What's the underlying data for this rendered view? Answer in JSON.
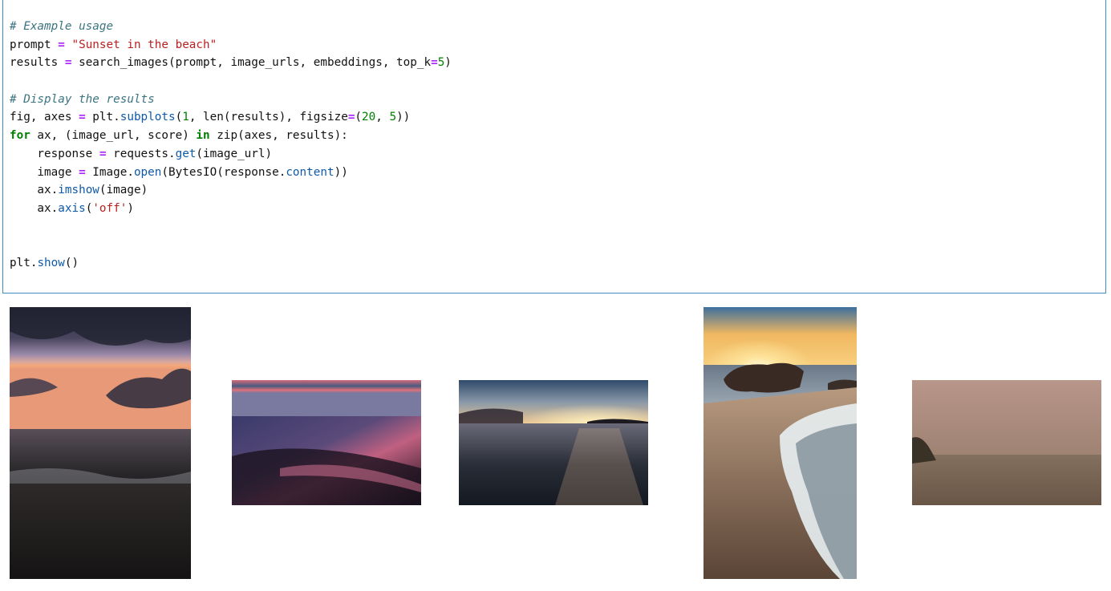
{
  "code_cell": {
    "lines": [
      [
        {
          "t": "comment",
          "v": "# Example usage"
        }
      ],
      [
        {
          "t": "plain",
          "v": "prompt "
        },
        {
          "t": "op",
          "v": "="
        },
        {
          "t": "plain",
          "v": " "
        },
        {
          "t": "string",
          "v": "\"Sunset in the beach\""
        }
      ],
      [
        {
          "t": "plain",
          "v": "results "
        },
        {
          "t": "op",
          "v": "="
        },
        {
          "t": "plain",
          "v": " search_images(prompt, image_urls, embeddings, top_k"
        },
        {
          "t": "op",
          "v": "="
        },
        {
          "t": "num",
          "v": "5"
        },
        {
          "t": "plain",
          "v": ")"
        }
      ],
      [],
      [
        {
          "t": "comment",
          "v": "# Display the results"
        }
      ],
      [
        {
          "t": "plain",
          "v": "fig, axes "
        },
        {
          "t": "op",
          "v": "="
        },
        {
          "t": "plain",
          "v": " plt"
        },
        {
          "t": "plain",
          "v": "."
        },
        {
          "t": "attr",
          "v": "subplots"
        },
        {
          "t": "plain",
          "v": "("
        },
        {
          "t": "num",
          "v": "1"
        },
        {
          "t": "plain",
          "v": ", len(results), figsize"
        },
        {
          "t": "op",
          "v": "="
        },
        {
          "t": "plain",
          "v": "("
        },
        {
          "t": "num",
          "v": "20"
        },
        {
          "t": "plain",
          "v": ", "
        },
        {
          "t": "num",
          "v": "5"
        },
        {
          "t": "plain",
          "v": "))"
        }
      ],
      [
        {
          "t": "kw",
          "v": "for"
        },
        {
          "t": "plain",
          "v": " ax, (image_url, score) "
        },
        {
          "t": "kw",
          "v": "in"
        },
        {
          "t": "plain",
          "v": " zip(axes, results):"
        }
      ],
      [
        {
          "t": "plain",
          "v": "    response "
        },
        {
          "t": "op",
          "v": "="
        },
        {
          "t": "plain",
          "v": " requests"
        },
        {
          "t": "plain",
          "v": "."
        },
        {
          "t": "attr",
          "v": "get"
        },
        {
          "t": "plain",
          "v": "(image_url)"
        }
      ],
      [
        {
          "t": "plain",
          "v": "    image "
        },
        {
          "t": "op",
          "v": "="
        },
        {
          "t": "plain",
          "v": " Image"
        },
        {
          "t": "plain",
          "v": "."
        },
        {
          "t": "attr",
          "v": "open"
        },
        {
          "t": "plain",
          "v": "(BytesIO(response"
        },
        {
          "t": "plain",
          "v": "."
        },
        {
          "t": "attr",
          "v": "content"
        },
        {
          "t": "plain",
          "v": "))"
        }
      ],
      [
        {
          "t": "plain",
          "v": "    ax"
        },
        {
          "t": "plain",
          "v": "."
        },
        {
          "t": "attr",
          "v": "imshow"
        },
        {
          "t": "plain",
          "v": "(image)"
        }
      ],
      [
        {
          "t": "plain",
          "v": "    ax"
        },
        {
          "t": "plain",
          "v": "."
        },
        {
          "t": "attr",
          "v": "axis"
        },
        {
          "t": "plain",
          "v": "("
        },
        {
          "t": "string",
          "v": "'off'"
        },
        {
          "t": "plain",
          "v": ")"
        }
      ],
      [],
      [],
      [
        {
          "t": "plain",
          "v": "plt"
        },
        {
          "t": "plain",
          "v": "."
        },
        {
          "t": "attr",
          "v": "show"
        },
        {
          "t": "plain",
          "v": "()"
        }
      ]
    ]
  },
  "colors": {
    "cell_border": "#3d8ec4",
    "comment": "#3b7480",
    "string": "#ba2121",
    "operator": "#aa22ff",
    "keyword": "#008000",
    "number": "#008000",
    "attribute": "#0f5aa8"
  },
  "output_images": [
    {
      "name": "result-image-1",
      "subject": "purple sunset clouds over sea with dark sand beach"
    },
    {
      "name": "result-image-2",
      "subject": "long exposure pink sunset beach with reflections"
    },
    {
      "name": "result-image-3",
      "subject": "sunset over rocky sea with islands on horizon"
    },
    {
      "name": "result-image-4",
      "subject": "sun over rocks with waves on sandy beach"
    },
    {
      "name": "result-image-5",
      "subject": "hazy brown sea horizon with small island"
    }
  ]
}
